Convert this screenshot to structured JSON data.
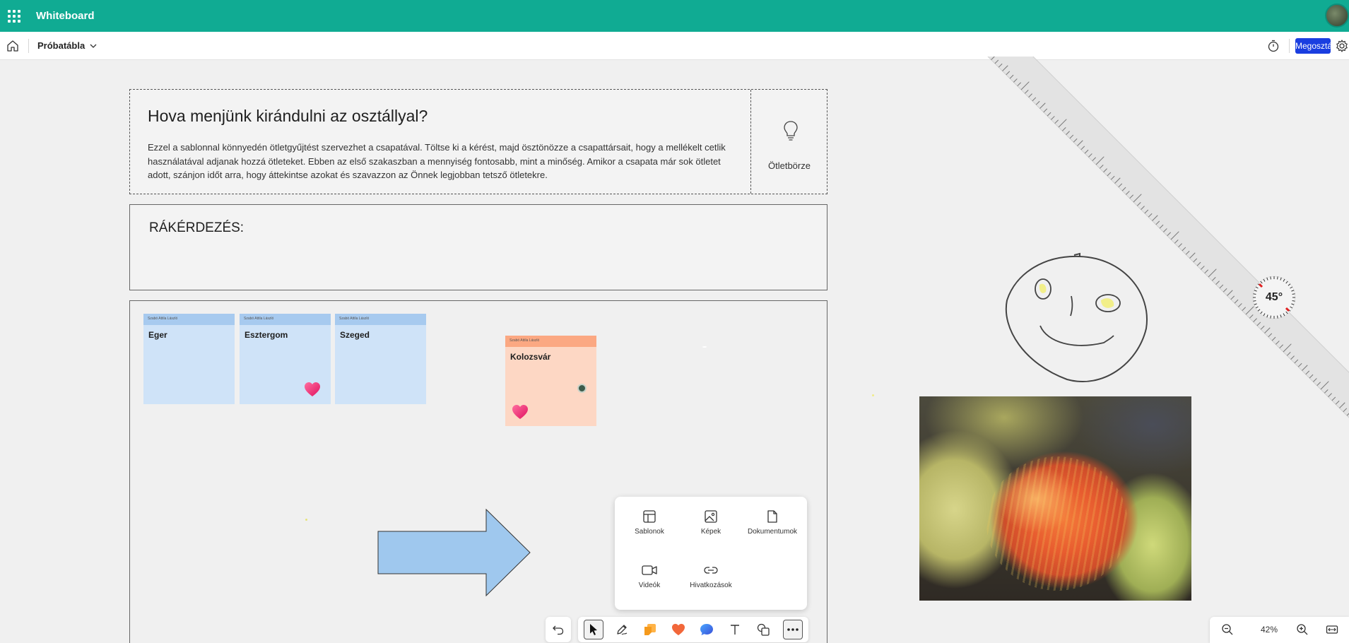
{
  "app": {
    "title": "Whiteboard"
  },
  "toolbar": {
    "board_name": "Próbatábla",
    "share_label": "Megosztás"
  },
  "template": {
    "title": "Hova menjünk kirándulni az osztállyal?",
    "description": "Ezzel a sablonnal könnyedén ötletgyűjtést szervezhet a csapatával. Töltse ki a kérést, majd ösztönözze a csapattársait, hogy a mellékelt cetlik használatával adjanak hozzá ötleteket. Ebben az első szakaszban a mennyiség fontosabb, mint a minőség. Amikor a csapata már sok ötletet adott, szánjon időt arra, hogy áttekintse azokat és szavazzon az Önnek legjobban tetsző ötletekre.",
    "side_label": "Ötletbörze",
    "question_label": "RÁKÉRDEZÉS:"
  },
  "notes": [
    {
      "author": "Szabó Attila László",
      "text": "Eger",
      "color": "#cfe3f8",
      "heart": false
    },
    {
      "author": "Szabó Attila László",
      "text": "Esztergom",
      "color": "#cfe3f8",
      "heart": true
    },
    {
      "author": "Szabó Attila László",
      "text": "Szeged",
      "color": "#cfe3f8",
      "heart": false
    },
    {
      "author": "Szabó Attila László",
      "text": "Kolozsvár",
      "color": "#fdd7c4",
      "heart": true
    }
  ],
  "ruler": {
    "angle_label": "45°"
  },
  "insert_menu": {
    "templates": "Sablonok",
    "images": "Képek",
    "documents": "Dokumentumok",
    "videos": "Videók",
    "links": "Hivatkozások"
  },
  "zoom": {
    "level": "42%"
  },
  "colors": {
    "brand": "#10ab93",
    "share": "#1a3ee0",
    "note_blue": "#cfe3f8",
    "note_orange": "#fdd7c4"
  }
}
